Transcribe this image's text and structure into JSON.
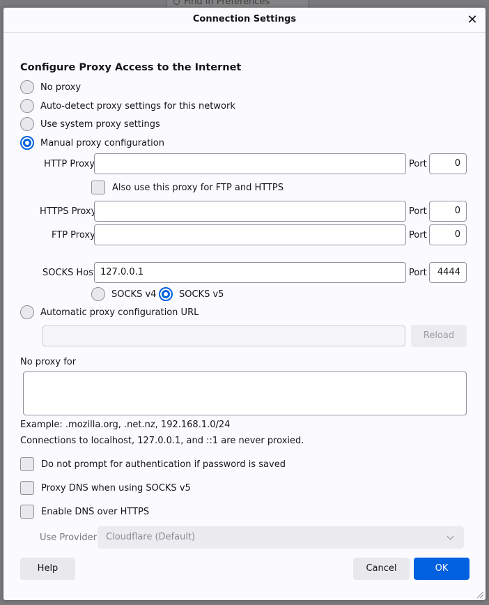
{
  "background": {
    "search_placeholder": "Find in Preferences"
  },
  "dialog": {
    "title": "Connection Settings",
    "heading": "Configure Proxy Access to the Internet",
    "proxy_options": [
      {
        "label": "No proxy",
        "checked": false
      },
      {
        "label": "Auto-detect proxy settings for this network",
        "checked": false
      },
      {
        "label": "Use system proxy settings",
        "checked": false
      },
      {
        "label": "Manual proxy configuration",
        "checked": true
      }
    ],
    "http": {
      "label": "HTTP Proxy",
      "value": "",
      "port_label": "Port",
      "port": "0"
    },
    "also_use_label": "Also use this proxy for FTP and HTTPS",
    "https": {
      "label": "HTTPS Proxy",
      "value": "",
      "port_label": "Port",
      "port": "0"
    },
    "ftp": {
      "label": "FTP Proxy",
      "value": "",
      "port_label": "Port",
      "port": "0"
    },
    "socks": {
      "label": "SOCKS Host",
      "value": "127.0.0.1",
      "port_label": "Port",
      "port": "4444"
    },
    "socks_versions": [
      {
        "label": "SOCKS v4",
        "checked": false
      },
      {
        "label": "SOCKS v5",
        "checked": true
      }
    ],
    "auto_config": {
      "label": "Automatic proxy configuration URL",
      "value": "",
      "reload_label": "Reload"
    },
    "no_proxy": {
      "label": "No proxy for",
      "value": "",
      "example": "Example: .mozilla.org, .net.nz, 192.168.1.0/24",
      "note": "Connections to localhost, 127.0.0.1, and ::1 are never proxied."
    },
    "checkboxes": [
      {
        "label": "Do not prompt for authentication if password is saved"
      },
      {
        "label": "Proxy DNS when using SOCKS v5"
      },
      {
        "label": "Enable DNS over HTTPS"
      }
    ],
    "provider": {
      "label": "Use Provider",
      "value": "Cloudflare (Default)"
    },
    "buttons": {
      "help": "Help",
      "cancel": "Cancel",
      "ok": "OK"
    }
  },
  "colors": {
    "accent": "#0061e0",
    "surface": "#fbfbfe"
  }
}
